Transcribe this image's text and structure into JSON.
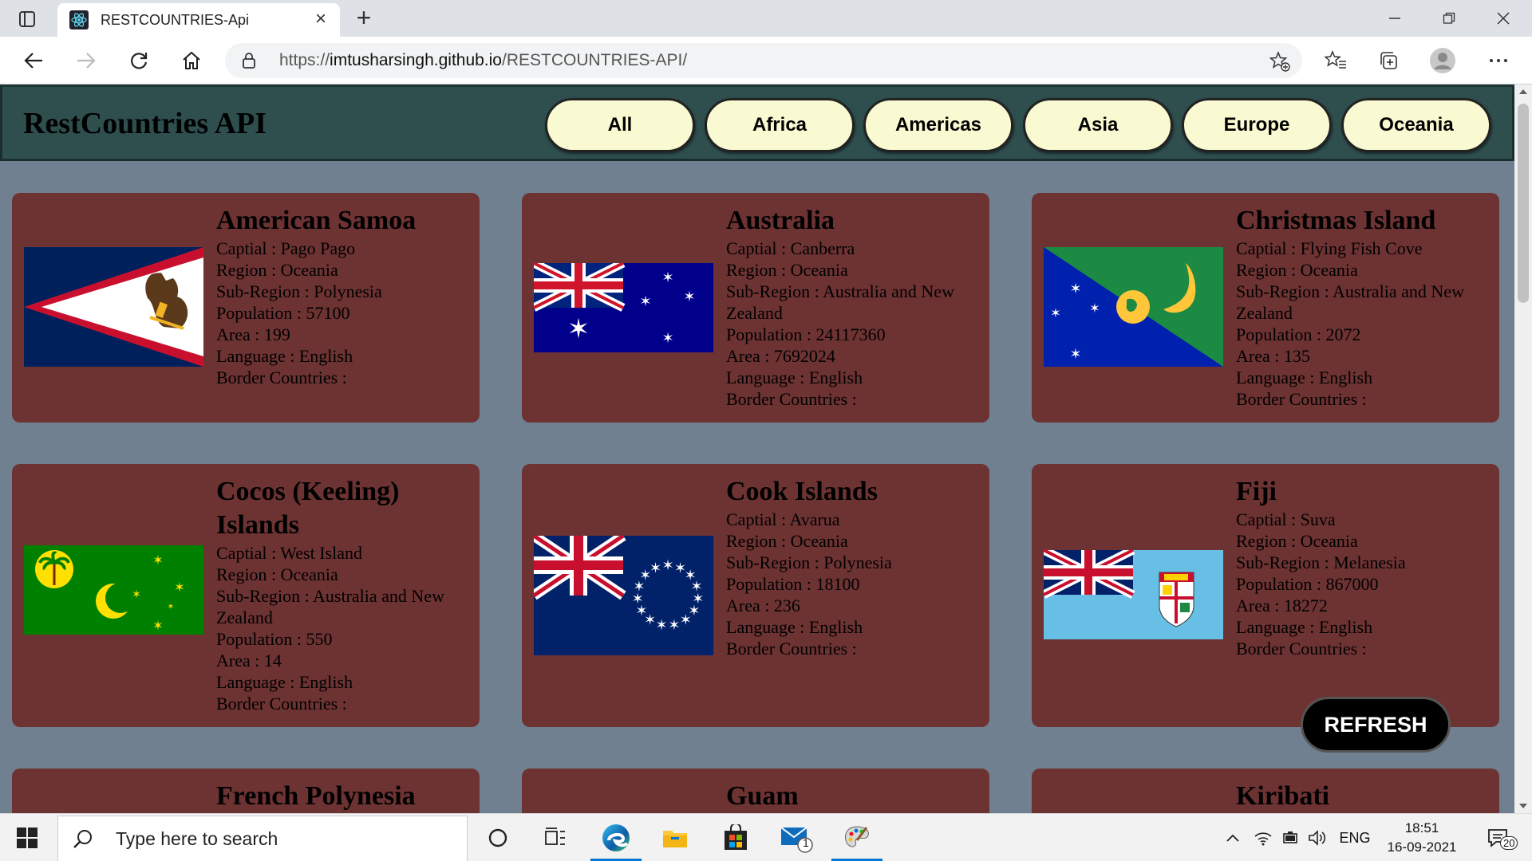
{
  "browser": {
    "tab_title": "RESTCOUNTRIES-Api",
    "url_scheme": "https://",
    "url_host": "imtusharsingh.github.io",
    "url_path": "/RESTCOUNTRIES-API/"
  },
  "site": {
    "title": "RestCountries API",
    "regions": [
      "All",
      "Africa",
      "Americas",
      "Asia",
      "Europe",
      "Oceania"
    ],
    "refresh_label": "REFRESH"
  },
  "labels": {
    "capital": "Captial : ",
    "region": "Region : ",
    "subregion": "Sub-Region : ",
    "population": "Population : ",
    "area": "Area : ",
    "language": "Language : ",
    "borders": "Border Countries : "
  },
  "countries": [
    {
      "name": "American Samoa",
      "capital": "Pago Pago",
      "region": "Oceania",
      "subregion": "Polynesia",
      "population": "57100",
      "area": "199",
      "language": "English",
      "borders": "",
      "flag": "american-samoa-flag"
    },
    {
      "name": "Australia",
      "capital": "Canberra",
      "region": "Oceania",
      "subregion": "Australia and New Zealand",
      "population": "24117360",
      "area": "7692024",
      "language": "English",
      "borders": "",
      "flag": "australia-flag"
    },
    {
      "name": "Christmas Island",
      "capital": "Flying Fish Cove",
      "region": "Oceania",
      "subregion": "Australia and New Zealand",
      "population": "2072",
      "area": "135",
      "language": "English",
      "borders": "",
      "flag": "christmas-island-flag"
    },
    {
      "name": "Cocos (Keeling) Islands",
      "capital": "West Island",
      "region": "Oceania",
      "subregion": "Australia and New Zealand",
      "population": "550",
      "area": "14",
      "language": "English",
      "borders": "",
      "flag": "cocos-islands-flag"
    },
    {
      "name": "Cook Islands",
      "capital": "Avarua",
      "region": "Oceania",
      "subregion": "Polynesia",
      "population": "18100",
      "area": "236",
      "language": "English",
      "borders": "",
      "flag": "cook-islands-flag"
    },
    {
      "name": "Fiji",
      "capital": "Suva",
      "region": "Oceania",
      "subregion": "Melanesia",
      "population": "867000",
      "area": "18272",
      "language": "English",
      "borders": "",
      "flag": "fiji-flag"
    },
    {
      "name": "French Polynesia"
    },
    {
      "name": "Guam"
    },
    {
      "name": "Kiribati"
    }
  ],
  "taskbar": {
    "search_placeholder": "Type here to search",
    "language": "ENG",
    "time": "18:51",
    "date": "16-09-2021",
    "mail_badge": "1",
    "notification_count": "20"
  }
}
